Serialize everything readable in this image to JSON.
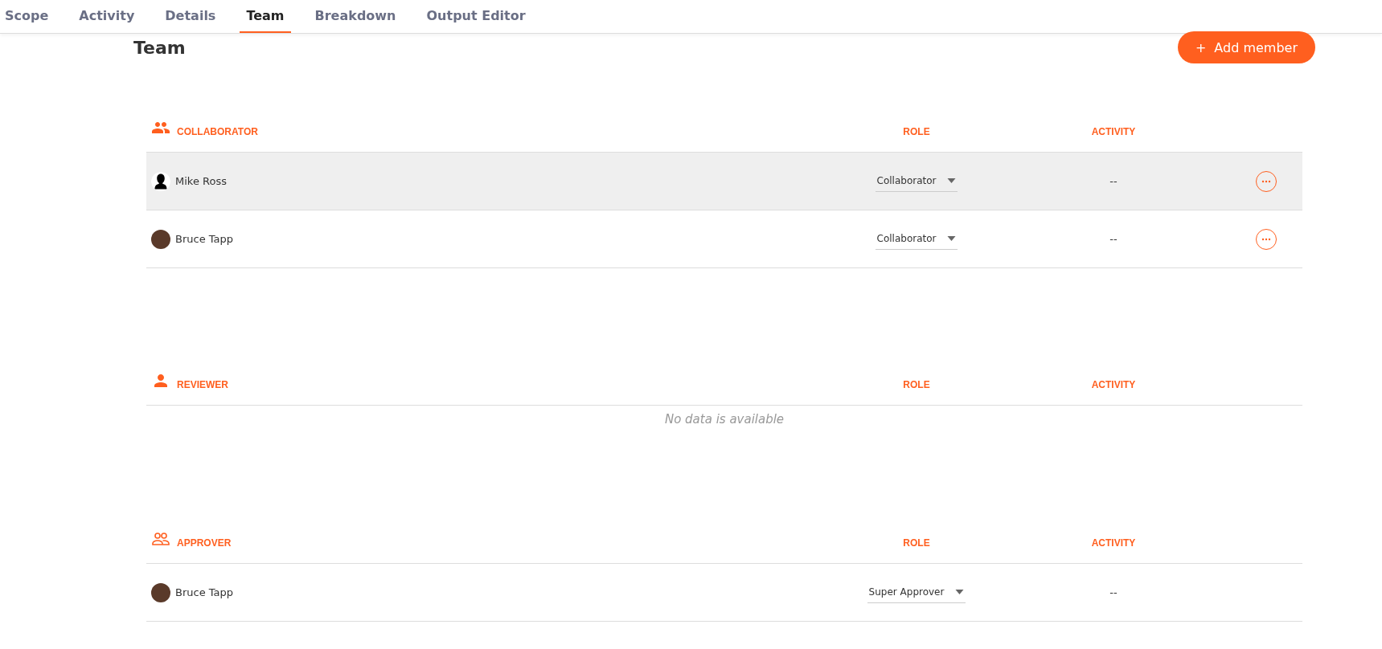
{
  "tabs": [
    {
      "label": "Scope",
      "selected": false
    },
    {
      "label": "Activity",
      "selected": false
    },
    {
      "label": "Details",
      "selected": false
    },
    {
      "label": "Team",
      "selected": true
    },
    {
      "label": "Breakdown",
      "selected": false
    },
    {
      "label": "Output Editor",
      "selected": false
    }
  ],
  "page_title": "Team",
  "add_button": {
    "icon": "+",
    "label": "Add member"
  },
  "sections": [
    {
      "kind": "group",
      "title": "COLLABORATOR",
      "columns": [
        "ROLE",
        "ACTIVITY"
      ],
      "rows": [
        {
          "name": "Mike Ross",
          "kind": "silhouette",
          "role": "Collaborator",
          "activity": "--",
          "highlighted": true,
          "more_button": true
        },
        {
          "name": "Bruce Tapp",
          "kind": "photo",
          "role": "Collaborator",
          "activity": "--",
          "highlighted": false,
          "more_button": true
        }
      ]
    },
    {
      "kind": "person",
      "title": "REVIEWER",
      "columns": [
        "ROLE",
        "ACTIVITY"
      ],
      "empty_text": "No data is available"
    },
    {
      "kind": "group-outline",
      "title": "APPROVER",
      "columns": [
        "ROLE",
        "ACTIVITY"
      ],
      "rows": [
        {
          "name": "Bruce Tapp",
          "kind": "photo",
          "role": "Super Approver",
          "activity": "--",
          "highlighted": false,
          "more_button": false
        }
      ]
    }
  ]
}
